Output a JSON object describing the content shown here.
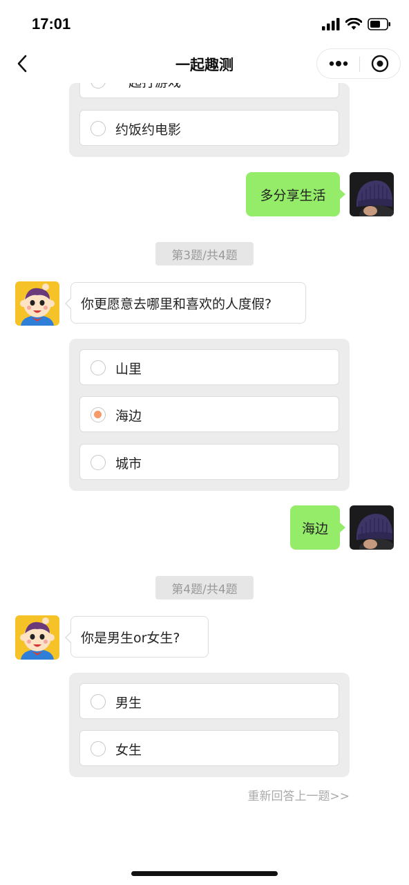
{
  "status_bar": {
    "time": "17:01"
  },
  "nav": {
    "title": "一起趣测",
    "back_icon": "chevron-left-icon",
    "more_icon": "more-dots-icon",
    "close_icon": "target-close-icon"
  },
  "chat": {
    "prev_options": [
      {
        "label": "一起打游戏",
        "selected": false
      },
      {
        "label": "约饭约电影",
        "selected": false
      }
    ],
    "prev_answer": "多分享生活",
    "q3": {
      "progress": "第3题/共4题",
      "question": "你更愿意去哪里和喜欢的人度假?",
      "options": [
        {
          "label": "山里",
          "selected": false
        },
        {
          "label": "海边",
          "selected": true
        },
        {
          "label": "城市",
          "selected": false
        }
      ],
      "answer": "海边"
    },
    "q4": {
      "progress": "第4题/共4题",
      "question": "你是男生or女生?",
      "options": [
        {
          "label": "男生",
          "selected": false
        },
        {
          "label": "女生",
          "selected": false
        }
      ]
    },
    "retry_link": "重新回答上一题>>"
  },
  "colors": {
    "user_bubble": "#95ec69",
    "selected_radio": "#f79a6a",
    "options_card_bg": "#ececec",
    "bot_avatar_bg": "#f5c227"
  }
}
